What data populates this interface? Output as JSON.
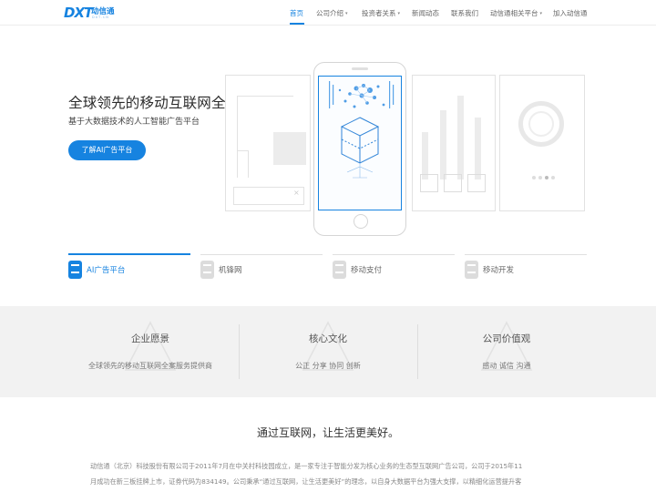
{
  "header": {
    "logo_mark": "DXT",
    "logo_cn": "动信通",
    "logo_en": "DXT.CN",
    "nav": [
      {
        "label": "首页",
        "active": true,
        "dropdown": false
      },
      {
        "label": "公司介绍",
        "active": false,
        "dropdown": true
      },
      {
        "label": "投资者关系",
        "active": false,
        "dropdown": true
      },
      {
        "label": "新闻动态",
        "active": false,
        "dropdown": false
      },
      {
        "label": "联系我们",
        "active": false,
        "dropdown": false
      },
      {
        "label": "动信通相关平台",
        "active": false,
        "dropdown": true
      },
      {
        "label": "加入动信通",
        "active": false,
        "dropdown": false
      }
    ],
    "caret": "▾"
  },
  "hero": {
    "title": "全球领先的移动互联网全案服务商",
    "subtitle": "基于大数据技术的人工智能广告平台",
    "button_label": "了解AI广告平台"
  },
  "tabs": [
    {
      "label": "AI广告平台",
      "active": true
    },
    {
      "label": "机锋网",
      "active": false
    },
    {
      "label": "移动支付",
      "active": false
    },
    {
      "label": "移动开发",
      "active": false
    }
  ],
  "values": [
    {
      "title": "企业愿景",
      "text": "全球领先的移动互联网全案服务提供商"
    },
    {
      "title": "核心文化",
      "text": "公正  分享  协同  创新"
    },
    {
      "title": "公司价值观",
      "text": "感动  诚信  沟通"
    }
  ],
  "about": {
    "title": "通过互联网，让生活更美好。",
    "lines": [
      "动信通（北京）科技股份有限公司于2011年7月在中关村科技园成立，是一家专注于智能分发为核心业务的生态型互联网广告公司，公司于2015年11",
      "月成功在新三板挂牌上市，证券代码为834149。公司秉承“通过互联网，让生活更美好”的理念，以自身大数据平台为强大支撑，以精细化运营提升客"
    ]
  },
  "colors": {
    "accent": "#1683e0",
    "band": "#f2f2f2"
  }
}
